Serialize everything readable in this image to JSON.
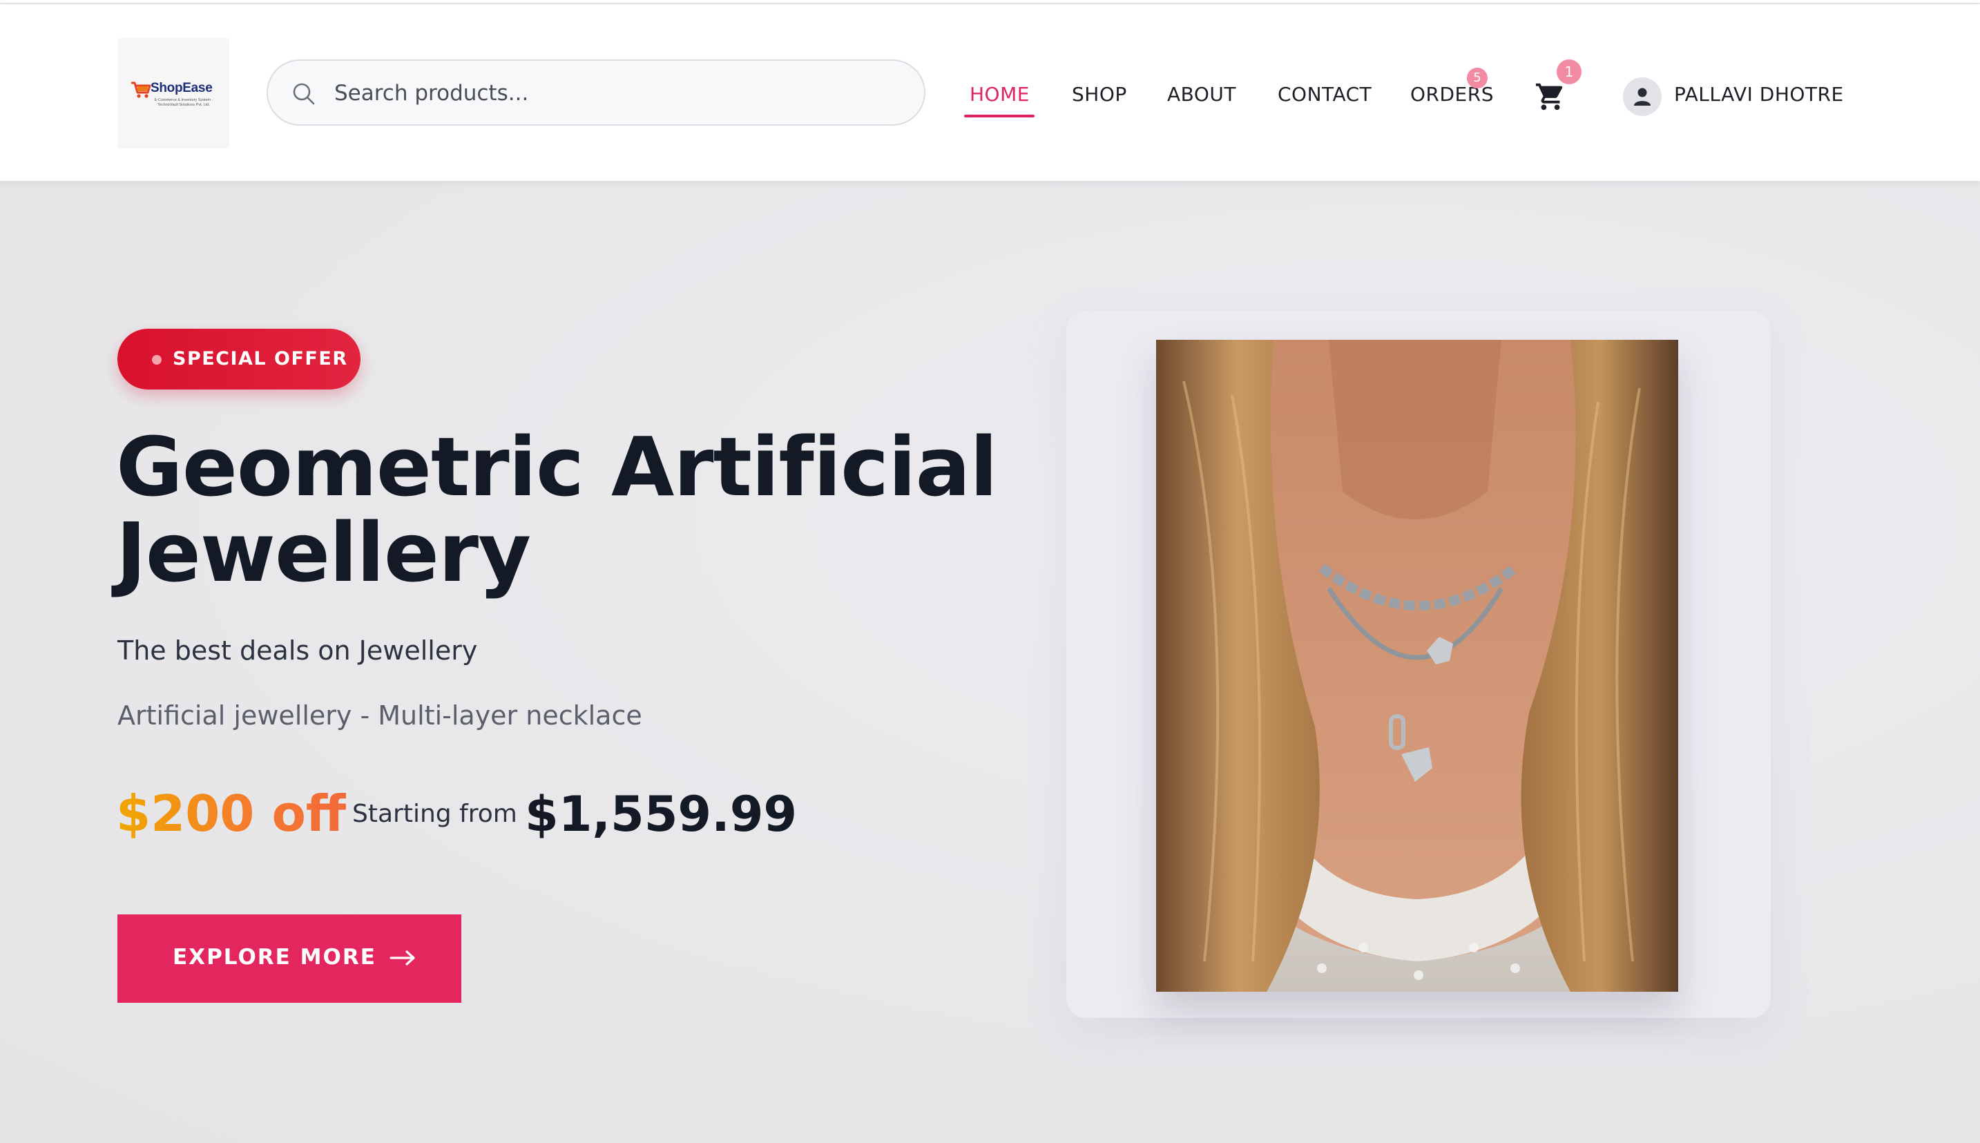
{
  "header": {
    "logo": {
      "name": "ShopEase",
      "tagline": "E-Commerce & Inventory System · TechnoVault Solutions Pvt. Ltd."
    },
    "search": {
      "placeholder": "Search products..."
    },
    "nav": [
      {
        "label": "HOME",
        "active": true
      },
      {
        "label": "SHOP"
      },
      {
        "label": "ABOUT"
      },
      {
        "label": "CONTACT"
      },
      {
        "label": "ORDERS",
        "badge": "5"
      }
    ],
    "cart": {
      "icon": "cart-icon",
      "badge": "1"
    },
    "user": {
      "icon": "user-icon",
      "name": "PALLAVI DHOTRE"
    }
  },
  "hero": {
    "badge": "SPECIAL OFFER",
    "title": "Geometric Artificial Jewellery",
    "subtitle": "The best deals on Jewellery",
    "description": "Artificial jewellery - Multi-layer necklace",
    "discount": "$200 off",
    "starting_label": "Starting from",
    "price": "$1,559.99",
    "cta": "EXPLORE MORE"
  },
  "colors": {
    "accent": "#e0245e",
    "offer_badge": "#d8112d",
    "discount_start": "#f0a800",
    "discount_end": "#f26a3a",
    "text_dark": "#141926"
  }
}
